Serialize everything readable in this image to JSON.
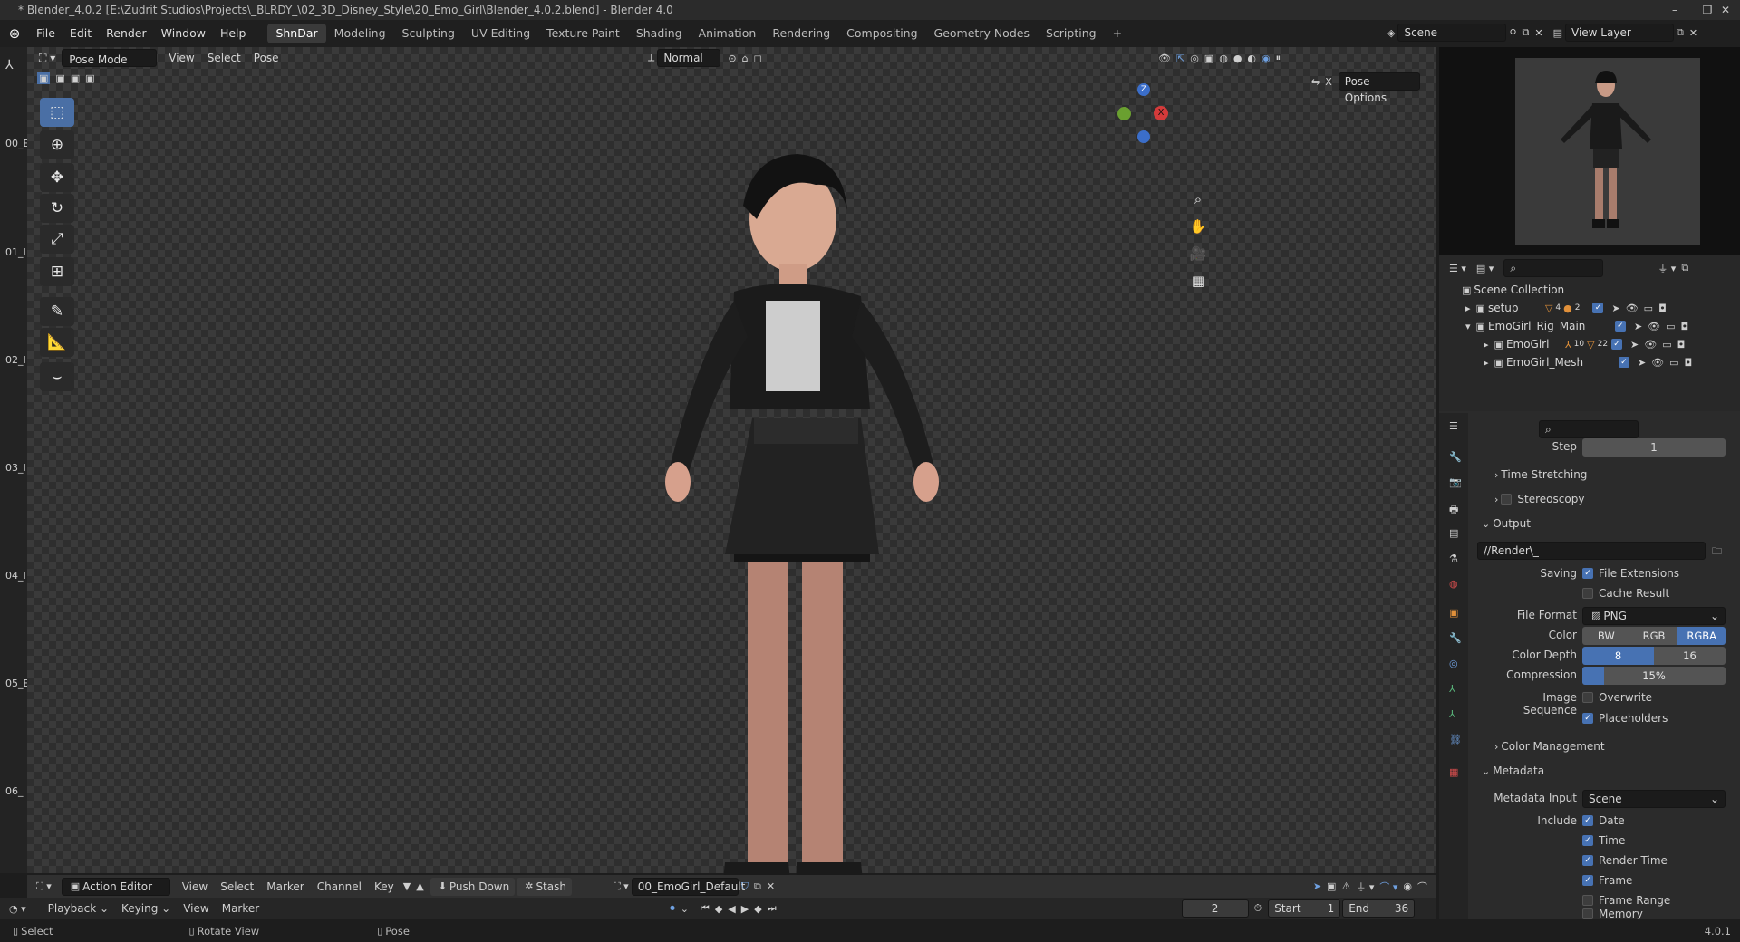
{
  "window": {
    "title": "* Blender_4.0.2 [E:\\Zudrit Studios\\Projects\\_BLRDY_\\02_3D_Disney_Style\\20_Emo_Girl\\Blender_4.0.2.blend] - Blender 4.0",
    "minimize": "–",
    "maximize": "❐",
    "close": "✕"
  },
  "menus": [
    "File",
    "Edit",
    "Render",
    "Window",
    "Help"
  ],
  "workspaces": [
    "ShnDar",
    "Modeling",
    "Sculpting",
    "UV Editing",
    "Texture Paint",
    "Shading",
    "Animation",
    "Rendering",
    "Compositing",
    "Geometry Nodes",
    "Scripting"
  ],
  "workspaces_add": "+",
  "scene": {
    "label": "Scene",
    "view_layer": "View Layer"
  },
  "viewport_header": {
    "mode": "Pose Mode",
    "menus": [
      "View",
      "Select",
      "Pose"
    ],
    "orientation": "Normal",
    "pose_options": "Pose Options"
  },
  "left_strip_labels": [
    "00_E",
    "01_I",
    "02_I",
    "03_I",
    "04_I",
    "05_E",
    "06_"
  ],
  "gizmo": {
    "z": "Z",
    "x": "X"
  },
  "outliner": {
    "search_placeholder": "",
    "root": "Scene Collection",
    "items": [
      {
        "name": "setup",
        "badge": "4",
        "badge2": "2"
      },
      {
        "name": "EmoGirl_Rig_Main"
      },
      {
        "name": "EmoGirl",
        "badge": "10",
        "badge2": "22"
      },
      {
        "name": "EmoGirl_Mesh"
      }
    ]
  },
  "properties": {
    "step_label": "Step",
    "step_value": "1",
    "time_stretching": "Time Stretching",
    "stereoscopy": "Stereoscopy",
    "output_header": "Output",
    "output_path": "//Render\\_",
    "saving_label": "Saving",
    "file_extensions": "File Extensions",
    "cache_result": "Cache Result",
    "file_format_label": "File Format",
    "file_format": "PNG",
    "color_label": "Color",
    "color_options": [
      "BW",
      "RGB",
      "RGBA"
    ],
    "color_selected": "RGBA",
    "color_depth_label": "Color Depth",
    "color_depth_options": [
      "8",
      "16"
    ],
    "color_depth_selected": "8",
    "compression_label": "Compression",
    "compression_value": "15%",
    "compression_fraction": 0.15,
    "image_sequence_label": "Image Sequence",
    "overwrite": "Overwrite",
    "placeholders": "Placeholders",
    "color_management": "Color Management",
    "metadata_header": "Metadata",
    "metadata_input_label": "Metadata Input",
    "metadata_input": "Scene",
    "include_label": "Include",
    "include_items": [
      "Date",
      "Time",
      "Render Time",
      "Frame",
      "Frame Range",
      "Memory"
    ]
  },
  "action_editor": {
    "editor": "Action Editor",
    "menus": [
      "View",
      "Select",
      "Marker",
      "Channel",
      "Key"
    ],
    "push_down": "Push Down",
    "stash": "Stash",
    "action": "00_EmoGirl_Default"
  },
  "playback": {
    "menus": [
      "Playback",
      "Keying",
      "View",
      "Marker"
    ],
    "current_frame": "2",
    "start_label": "Start",
    "start": "1",
    "end_label": "End",
    "end": "36"
  },
  "status": {
    "select": "Select",
    "rotate": "Rotate View",
    "pose": "Pose",
    "version": "4.0.1"
  },
  "colors": {
    "accent": "#4772b3",
    "active_ws": "#3a3a3a"
  }
}
